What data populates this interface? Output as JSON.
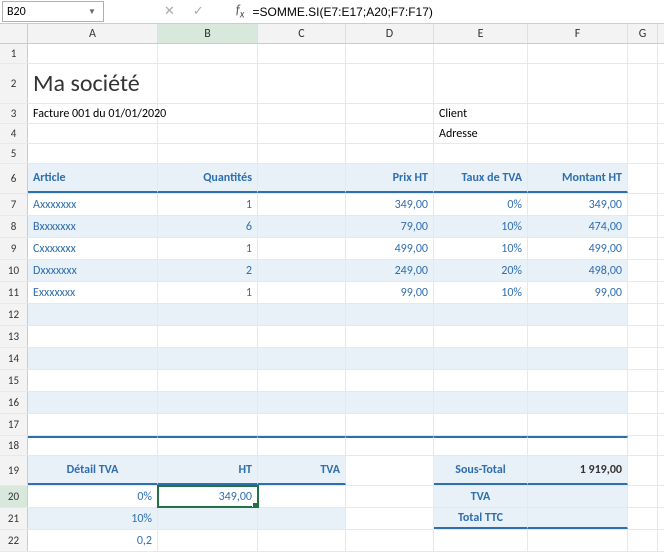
{
  "name_box": "B20",
  "formula": "=SOMME.SI(E7:E17;A20;F7:F17)",
  "columns": [
    "A",
    "B",
    "C",
    "D",
    "E",
    "F",
    "G"
  ],
  "title": "Ma société",
  "invoice_line": "Facture 001 du 01/01/2020",
  "client_label": "Client",
  "address_label": "Adresse",
  "table_headers": {
    "article": "Article",
    "qty": "Quantités",
    "prix": "Prix HT",
    "tva_rate": "Taux de TVA",
    "montant": "Montant HT"
  },
  "items": [
    {
      "article": "Axxxxxxx",
      "qty": "1",
      "prix": "349,00",
      "tva": "0%",
      "montant": "349,00"
    },
    {
      "article": "Bxxxxxxx",
      "qty": "6",
      "prix": "79,00",
      "tva": "10%",
      "montant": "474,00"
    },
    {
      "article": "Cxxxxxxx",
      "qty": "1",
      "prix": "499,00",
      "tva": "10%",
      "montant": "499,00"
    },
    {
      "article": "Dxxxxxxx",
      "qty": "2",
      "prix": "249,00",
      "tva": "20%",
      "montant": "498,00"
    },
    {
      "article": "Exxxxxxx",
      "qty": "1",
      "prix": "99,00",
      "tva": "10%",
      "montant": "99,00"
    }
  ],
  "detail": {
    "header_detail": "Détail TVA",
    "header_ht": "HT",
    "header_tva": "TVA",
    "row0_pct": "0%",
    "row0_ht": "349,00",
    "row1_pct": "10%",
    "row2_pct": "0,2"
  },
  "summary": {
    "subtotal_label": "Sous-Total",
    "subtotal_val": "1 919,00",
    "tva_label": "TVA",
    "total_label": "Total TTC"
  },
  "chart_data": {
    "type": "table",
    "title": "Facture (Invoice)",
    "columns": [
      "Article",
      "Quantités",
      "Prix HT",
      "Taux de TVA",
      "Montant HT"
    ],
    "rows": [
      [
        "Axxxxxxx",
        1,
        349.0,
        0.0,
        349.0
      ],
      [
        "Bxxxxxxx",
        6,
        79.0,
        0.1,
        474.0
      ],
      [
        "Cxxxxxxx",
        1,
        499.0,
        0.1,
        499.0
      ],
      [
        "Dxxxxxxx",
        2,
        249.0,
        0.2,
        498.0
      ],
      [
        "Exxxxxxx",
        1,
        99.0,
        0.1,
        99.0
      ]
    ],
    "subtotal": 1919.0
  }
}
